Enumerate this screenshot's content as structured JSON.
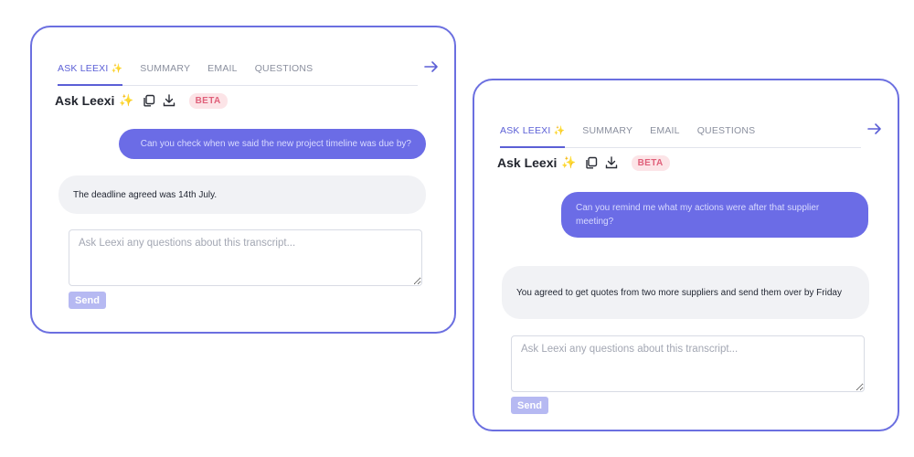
{
  "colors": {
    "accent": "#6b6ce6",
    "card_border": "#6b6fe0",
    "beta_bg": "#fce4e7",
    "beta_text": "#e0607a",
    "send_bg": "#b6b9f2"
  },
  "cards": [
    {
      "tabs": [
        "ASK LEEXI",
        "SUMMARY",
        "EMAIL",
        "QUESTIONS"
      ],
      "active_tab": "ASK LEEXI",
      "title": "Ask Leexi",
      "badge": "BETA",
      "user_message": "Can you check when we said the new project timeline was due by?",
      "bot_message": "The deadline agreed was 14th July.",
      "input_placeholder": "Ask Leexi any questions about this transcript...",
      "send_label": "Send"
    },
    {
      "tabs": [
        "ASK LEEXI",
        "SUMMARY",
        "EMAIL",
        "QUESTIONS"
      ],
      "active_tab": "ASK LEEXI",
      "title": "Ask Leexi",
      "badge": "BETA",
      "user_message": "Can you remind me what my actions were after that supplier meeting?",
      "bot_message": "You agreed to get quotes from two more suppliers and send them over by Friday",
      "input_placeholder": "Ask Leexi any questions about this transcript...",
      "send_label": "Send"
    }
  ],
  "icons": {
    "tab_spark": "sparkle-icon",
    "copy": "copy-icon",
    "download": "download-icon",
    "next": "arrow-right-icon"
  }
}
